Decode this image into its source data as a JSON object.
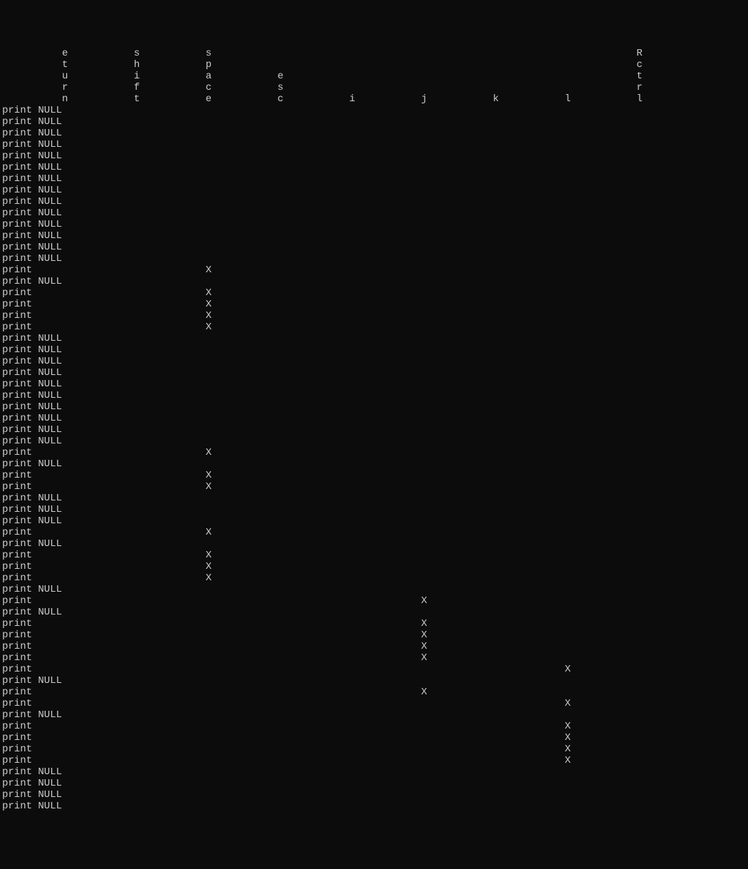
{
  "header_columns": [
    {
      "label": "eturn",
      "col": 10
    },
    {
      "label": "shift",
      "col": 22
    },
    {
      "label": "space",
      "col": 34
    },
    {
      "label": "esc",
      "col": 46
    },
    {
      "label": "i",
      "col": 58
    },
    {
      "label": "j",
      "col": 70
    },
    {
      "label": "k",
      "col": 82
    },
    {
      "label": "l",
      "col": 94
    },
    {
      "label": "Rctrl",
      "col": 106
    }
  ],
  "column_positions": {
    "eturn": 10,
    "shift": 22,
    "space": 34,
    "esc": 46,
    "i": 58,
    "j": 70,
    "k": 82,
    "l": 94,
    "Rctrl": 106
  },
  "row_prefix": "print",
  "null_token": "NULL",
  "mark": "X",
  "rows": [
    {
      "type": "null"
    },
    {
      "type": "null"
    },
    {
      "type": "null"
    },
    {
      "type": "null"
    },
    {
      "type": "null"
    },
    {
      "type": "null"
    },
    {
      "type": "null"
    },
    {
      "type": "null"
    },
    {
      "type": "null"
    },
    {
      "type": "null"
    },
    {
      "type": "null"
    },
    {
      "type": "null"
    },
    {
      "type": "null"
    },
    {
      "type": "null"
    },
    {
      "type": "mark",
      "col": "space"
    },
    {
      "type": "null"
    },
    {
      "type": "mark",
      "col": "space"
    },
    {
      "type": "mark",
      "col": "space"
    },
    {
      "type": "mark",
      "col": "space"
    },
    {
      "type": "mark",
      "col": "space"
    },
    {
      "type": "null"
    },
    {
      "type": "null"
    },
    {
      "type": "null"
    },
    {
      "type": "null"
    },
    {
      "type": "null"
    },
    {
      "type": "null"
    },
    {
      "type": "null"
    },
    {
      "type": "null"
    },
    {
      "type": "null"
    },
    {
      "type": "null"
    },
    {
      "type": "mark",
      "col": "space"
    },
    {
      "type": "null"
    },
    {
      "type": "mark",
      "col": "space"
    },
    {
      "type": "mark",
      "col": "space"
    },
    {
      "type": "null"
    },
    {
      "type": "null"
    },
    {
      "type": "null"
    },
    {
      "type": "mark",
      "col": "space"
    },
    {
      "type": "null"
    },
    {
      "type": "mark",
      "col": "space"
    },
    {
      "type": "mark",
      "col": "space"
    },
    {
      "type": "mark",
      "col": "space"
    },
    {
      "type": "null"
    },
    {
      "type": "mark",
      "col": "j"
    },
    {
      "type": "null"
    },
    {
      "type": "mark",
      "col": "j"
    },
    {
      "type": "mark",
      "col": "j"
    },
    {
      "type": "mark",
      "col": "j"
    },
    {
      "type": "mark",
      "col": "j"
    },
    {
      "type": "mark",
      "col": "l"
    },
    {
      "type": "null"
    },
    {
      "type": "mark",
      "col": "j"
    },
    {
      "type": "mark",
      "col": "l"
    },
    {
      "type": "null"
    },
    {
      "type": "mark",
      "col": "l"
    },
    {
      "type": "mark",
      "col": "l"
    },
    {
      "type": "mark",
      "col": "l"
    },
    {
      "type": "mark",
      "col": "l"
    },
    {
      "type": "null"
    },
    {
      "type": "null"
    },
    {
      "type": "null"
    },
    {
      "type": "null",
      "partial": true
    }
  ]
}
